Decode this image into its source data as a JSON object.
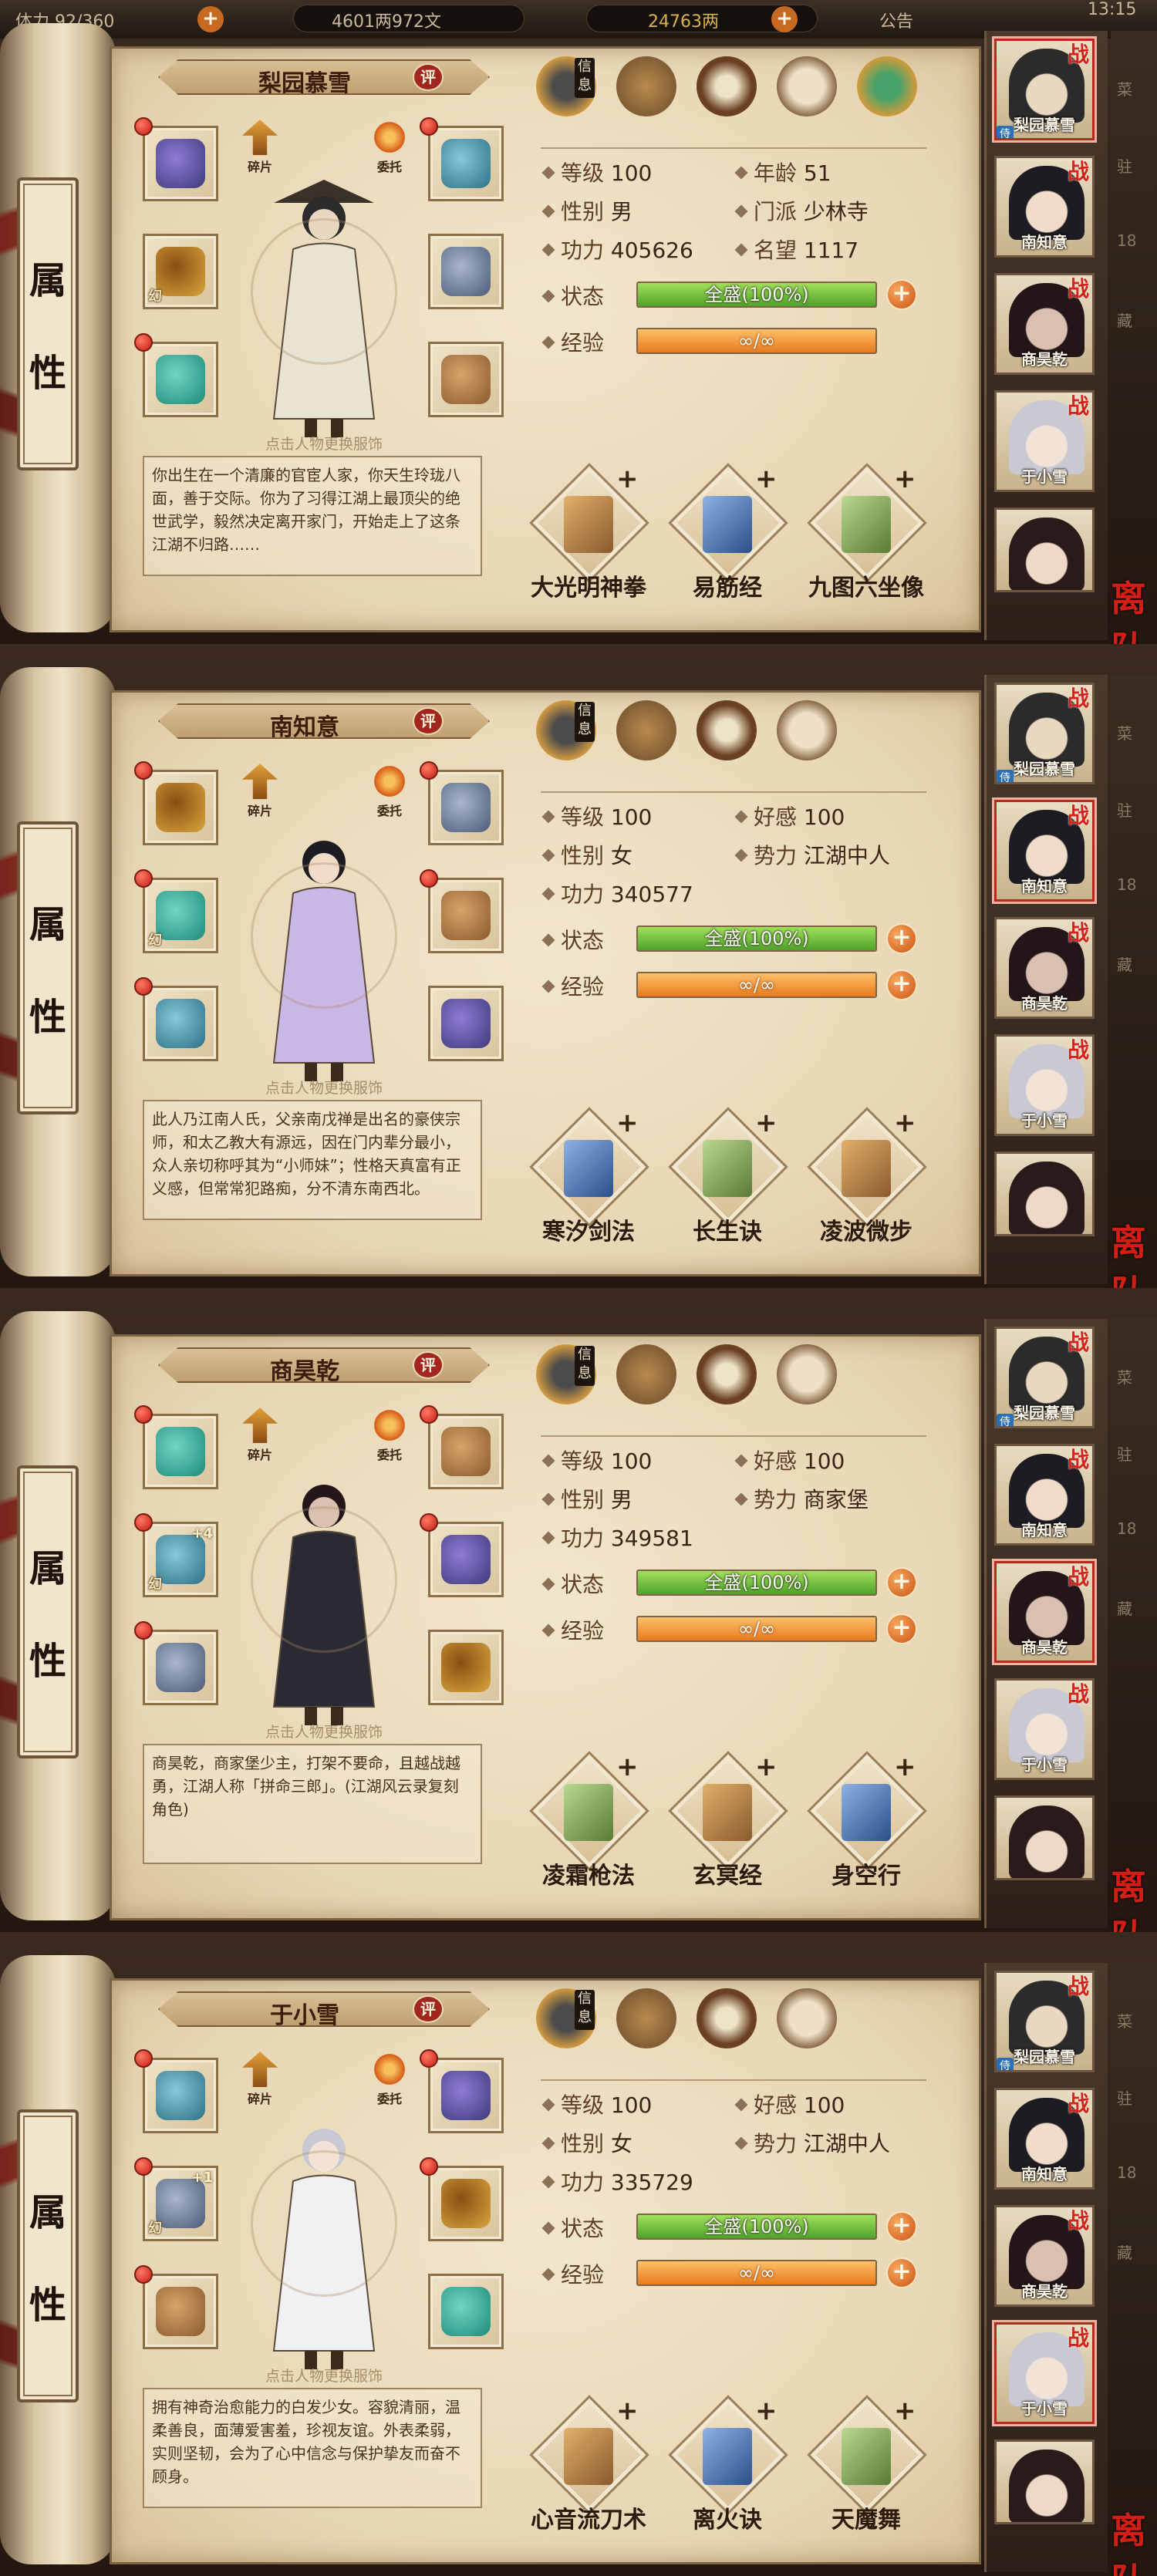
{
  "topbar": {
    "stamina": "体力 92/360",
    "silver": "4601两972文",
    "gold": "24763两",
    "notice": "公告",
    "time": "13:15"
  },
  "common": {
    "tab_label_1": "属",
    "tab_label_2": "性",
    "info_tag": "信息",
    "fragment_label": "碎片",
    "entrust_label": "委托",
    "hint": "点击人物更换服饰",
    "evaluate": "评",
    "status_label": "状态",
    "exp_label": "经验",
    "status_value": "全盛(100%)",
    "exp_value": "∞/∞",
    "add": "+",
    "level_label": "等级",
    "gender_label": "性别",
    "power_label": "功力",
    "leave_label": "离队",
    "war_mark": "战",
    "serve_mark": "侍",
    "illusion_tag": "幻",
    "roster": [
      "梨园慕雪",
      "南知意",
      "商昊乾",
      "于小雪"
    ],
    "edge_texts": [
      "菜",
      "驻",
      "18",
      "藏"
    ]
  },
  "colors": {
    "status_fill": "#4fa32b",
    "exp_fill": "#e87a1e",
    "evaluate_badge": "#a3261e",
    "leave_text": "#d21f16"
  },
  "characters": [
    {
      "name": "梨园慕雪",
      "level": "100",
      "gender": "男",
      "power": "405626",
      "extra1_label": "年龄",
      "extra1_value": "51",
      "extra2_label": "门派",
      "extra2_value": "少林寺",
      "extra3_label": "名望",
      "extra3_value": "1117",
      "bio": "你出生在一个清廉的官宦人家，你天生玲珑八面，善于交际。你为了习得江湖上最顶尖的绝世武学，毅然决定离开家门，开始走上了这条江湖不归路……",
      "skills": [
        "大光明神拳",
        "易筋经",
        "九图六坐像"
      ],
      "equip_plus": [
        "",
        "",
        "",
        "",
        "",
        ""
      ],
      "status_pct": 100,
      "tabs": 5
    },
    {
      "name": "南知意",
      "level": "100",
      "gender": "女",
      "power": "340577",
      "extra1_label": "好感",
      "extra1_value": "100",
      "extra2_label": "势力",
      "extra2_value": "江湖中人",
      "extra3_label": "",
      "extra3_value": "",
      "bio": "此人乃江南人氏，父亲南戊禅是出名的豪侠宗师，和太乙教大有源远，因在门内辈分最小，众人亲切称呼其为“小师妹”；性格天真富有正义感，但常常犯路痴，分不清东南西北。",
      "skills": [
        "寒汐剑法",
        "长生诀",
        "凌波微步"
      ],
      "equip_plus": [
        "",
        "",
        "",
        "",
        "",
        ""
      ],
      "status_pct": 100,
      "tabs": 4
    },
    {
      "name": "商昊乾",
      "level": "100",
      "gender": "男",
      "power": "349581",
      "extra1_label": "好感",
      "extra1_value": "100",
      "extra2_label": "势力",
      "extra2_value": "商家堡",
      "extra3_label": "",
      "extra3_value": "",
      "bio": "商昊乾，商家堡少主，打架不要命，且越战越勇，江湖人称「拼命三郎」。(江湖风云录复刻角色)",
      "skills": [
        "凌霜枪法",
        "玄冥经",
        "身空行"
      ],
      "equip_plus": [
        "",
        "+4",
        "",
        "",
        "",
        ""
      ],
      "status_pct": 100,
      "tabs": 4
    },
    {
      "name": "于小雪",
      "level": "100",
      "gender": "女",
      "power": "335729",
      "extra1_label": "好感",
      "extra1_value": "100",
      "extra2_label": "势力",
      "extra2_value": "江湖中人",
      "extra3_label": "",
      "extra3_value": "",
      "bio": "拥有神奇治愈能力的白发少女。容貌清丽，温柔善良，面薄爱害羞，珍视友谊。外表柔弱，实则坚韧，会为了心中信念与保护挚友而奋不顾身。",
      "skills": [
        "心音流刀术",
        "离火诀",
        "天魔舞"
      ],
      "equip_plus": [
        "",
        "+1",
        "",
        "",
        "",
        ""
      ],
      "status_pct": 100,
      "tabs": 4
    }
  ]
}
